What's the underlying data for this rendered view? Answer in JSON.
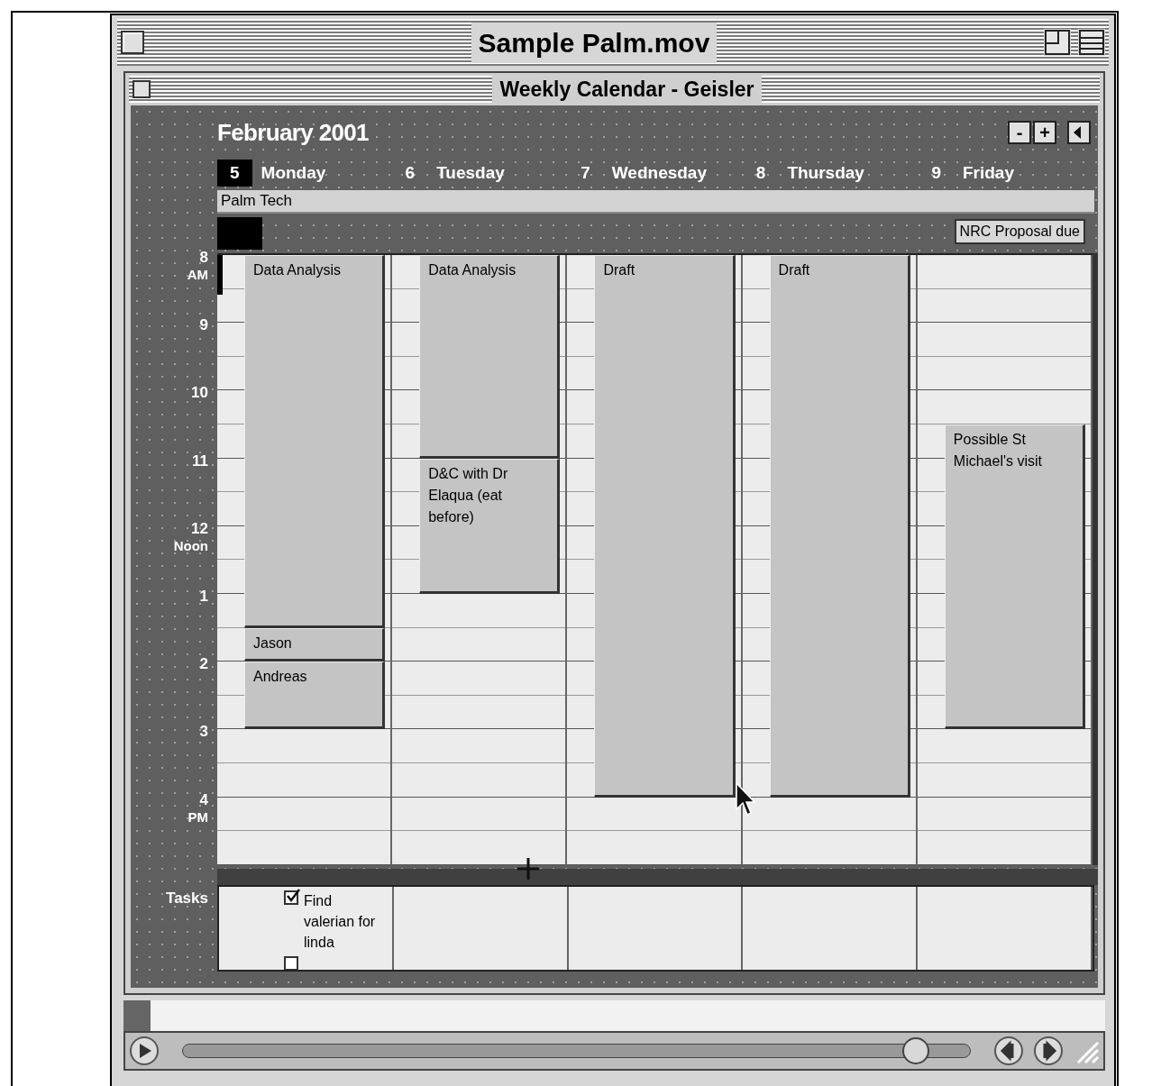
{
  "player": {
    "title": "Sample Palm.mov",
    "level": 0.93
  },
  "window": {
    "title": "Weekly Calendar - Geisler"
  },
  "header": {
    "month": "February 2001",
    "nav_buttons": [
      {
        "label": "-"
      },
      {
        "label": "+"
      }
    ]
  },
  "banner": "Palm Tech",
  "hours": [
    {
      "number": "8",
      "suffix": "AM"
    },
    {
      "number": "9"
    },
    {
      "number": "10"
    },
    {
      "number": "11"
    },
    {
      "number": "12",
      "suffix": "Noon"
    },
    {
      "number": "1"
    },
    {
      "number": "2"
    },
    {
      "number": "3"
    },
    {
      "number": "4",
      "suffix": "PM"
    }
  ],
  "tasks_label": "Tasks",
  "days": [
    {
      "date": "5",
      "name": "Monday",
      "selected": true,
      "events": [
        {
          "title": "Data Analysis"
        },
        {
          "title": "Jason"
        },
        {
          "title": "Andreas"
        }
      ],
      "tasks": [
        {
          "text": "Find valerian for linda",
          "checked": true
        },
        {
          "checked": false
        }
      ]
    },
    {
      "date": "6",
      "name": "Tuesday",
      "selected": false,
      "events": [
        {
          "title": "Data Analysis"
        },
        {
          "title": "D&C with Dr Elaqua (eat before)"
        }
      ]
    },
    {
      "date": "7",
      "name": "Wednesday",
      "selected": false,
      "events": [
        {
          "title": "Draft"
        }
      ]
    },
    {
      "date": "8",
      "name": "Thursday",
      "selected": false,
      "events": [
        {
          "title": "Draft"
        }
      ]
    },
    {
      "date": "9",
      "name": "Friday",
      "selected": false,
      "all_day": [
        {
          "title": "NRC Proposal due"
        }
      ],
      "events": [
        {
          "title": "Possible St Michael's visit"
        }
      ]
    }
  ]
}
